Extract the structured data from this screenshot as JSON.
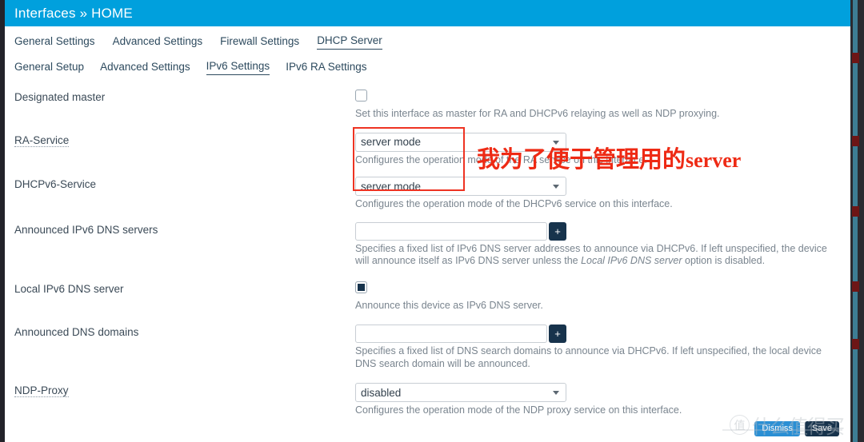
{
  "header": {
    "title": "Interfaces » HOME"
  },
  "tabs_primary": [
    {
      "label": "General Settings",
      "active": false
    },
    {
      "label": "Advanced Settings",
      "active": false
    },
    {
      "label": "Firewall Settings",
      "active": false
    },
    {
      "label": "DHCP Server",
      "active": true
    }
  ],
  "tabs_secondary": [
    {
      "label": "General Setup",
      "active": false
    },
    {
      "label": "Advanced Settings",
      "active": false
    },
    {
      "label": "IPv6 Settings",
      "active": true
    },
    {
      "label": "IPv6 RA Settings",
      "active": false
    }
  ],
  "form": {
    "designated_master": {
      "label": "Designated master",
      "checked": false,
      "desc": "Set this interface as master for RA and DHCPv6 relaying as well as NDP proxying."
    },
    "ra_service": {
      "label": "RA-Service",
      "value": "server mode",
      "desc": "Configures the operation mode of the RA service on this interface."
    },
    "dhcpv6_service": {
      "label": "DHCPv6-Service",
      "value": "server mode",
      "desc": "Configures the operation mode of the DHCPv6 service on this interface."
    },
    "announced_dns_servers": {
      "label": "Announced IPv6 DNS servers",
      "value": "",
      "add_label": "+",
      "desc_pre": "Specifies a fixed list of IPv6 DNS server addresses to announce via DHCPv6. If left unspecified, the device will announce itself as IPv6 DNS server unless the ",
      "desc_em": "Local IPv6 DNS server",
      "desc_post": " option is disabled."
    },
    "local_dns_server": {
      "label": "Local IPv6 DNS server",
      "checked": true,
      "desc": "Announce this device as IPv6 DNS server."
    },
    "announced_dns_domains": {
      "label": "Announced DNS domains",
      "value": "",
      "add_label": "+",
      "desc": "Specifies a fixed list of DNS search domains to announce via DHCPv6. If left unspecified, the local device DNS search domain will be announced."
    },
    "ndp_proxy": {
      "label": "NDP-Proxy",
      "value": "disabled",
      "desc": "Configures the operation mode of the NDP proxy service on this interface."
    }
  },
  "annotation": {
    "chinese": "我为了便于管理用的",
    "english": "server",
    "color": "#ee2a14",
    "box_color": "#ee3322"
  },
  "footer": {
    "dismiss_label": "Dismiss",
    "save_label": "Save"
  },
  "watermark": {
    "badge": "值",
    "text": "什么值得买"
  }
}
